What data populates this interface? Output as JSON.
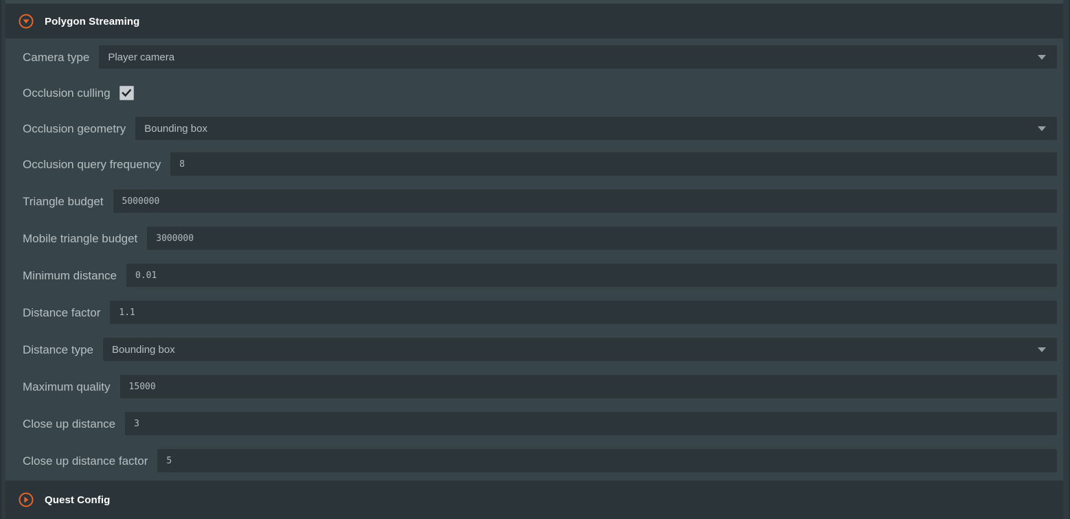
{
  "theme": {
    "page_background": "#37444a",
    "header_background": "#2b3439",
    "field_background": "#2b353a",
    "accent": "#e8662a",
    "label_color": "#b6c0c4",
    "title_color": "#ffffff",
    "checkbox_color": "#c9ced1"
  },
  "sections": {
    "polygon_streaming": {
      "title": "Polygon Streaming",
      "foldout_icon": "circle-triangle-down-icon",
      "expanded": true
    },
    "quest_config": {
      "title": "Quest Config",
      "foldout_icon": "circle-triangle-right-icon",
      "expanded": false
    }
  },
  "properties": [
    {
      "id": "camera-type",
      "label": "Camera type",
      "control": "popup",
      "value": "Player camera",
      "dropdown_icon": "chevron-down-icon"
    },
    {
      "id": "occlusion-culling",
      "label": "Occlusion culling",
      "control": "checkbox",
      "value": "checked",
      "check_icon": "check-icon"
    },
    {
      "id": "occlusion-geometry",
      "label": "Occlusion geometry",
      "control": "popup",
      "value": "Bounding box",
      "dropdown_icon": "chevron-down-icon"
    },
    {
      "id": "occlusion-query-frequency",
      "label": "Occlusion query frequency",
      "control": "number",
      "value": "8"
    },
    {
      "id": "triangle-budget",
      "label": "Triangle budget",
      "control": "number",
      "value": "5000000"
    },
    {
      "id": "mobile-triangle-budget",
      "label": "Mobile triangle budget",
      "control": "number",
      "value": "3000000"
    },
    {
      "id": "minimum-distance",
      "label": "Minimum distance",
      "control": "number",
      "value": "0.01"
    },
    {
      "id": "distance-factor",
      "label": "Distance factor",
      "control": "number",
      "value": "1.1"
    },
    {
      "id": "distance-type",
      "label": "Distance type",
      "control": "popup",
      "value": "Bounding box",
      "dropdown_icon": "chevron-down-icon"
    },
    {
      "id": "maximum-quality",
      "label": "Maximum quality",
      "control": "number",
      "value": "15000"
    },
    {
      "id": "close-up-distance",
      "label": "Close up distance",
      "control": "number",
      "value": "3"
    },
    {
      "id": "close-up-distance-factor",
      "label": "Close up distance factor",
      "control": "number",
      "value": "5"
    }
  ]
}
